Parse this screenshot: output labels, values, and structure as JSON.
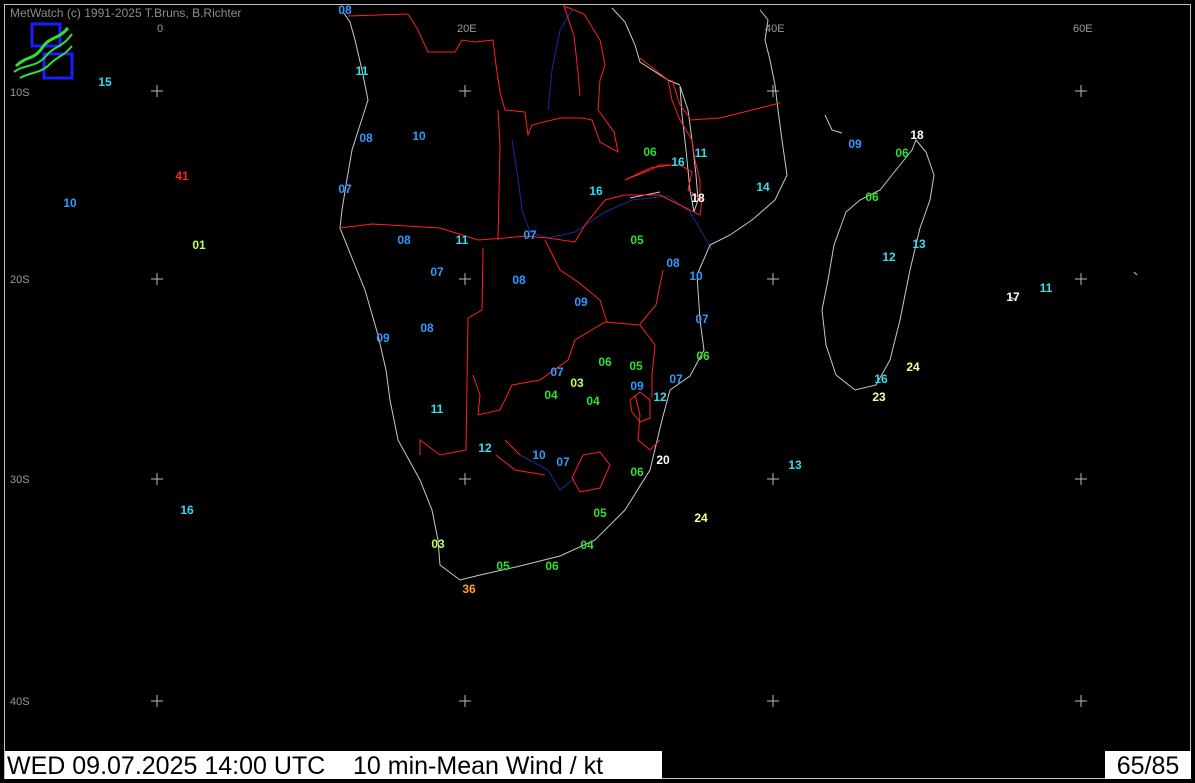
{
  "header": {
    "copyright": "MetWatch  (c) 1991-2025 T.Bruns, B.Richter"
  },
  "footer": {
    "datetime_product": "WED 09.07.2025 14:00 UTC    10 min-Mean Wind / kt",
    "station_count": "65/85"
  },
  "map": {
    "lon_labels": [
      "0",
      "20E",
      "40E",
      "60E"
    ],
    "lat_labels": [
      "10S",
      "20S",
      "30S",
      "40S"
    ],
    "colors": {
      "coast": "#c8c8c8",
      "border": "#ff2020",
      "river": "#1a2aa0",
      "grid": "#bbbbbb"
    },
    "legend_colors": {
      "blue": "#3399ff",
      "cyan": "#33ddee",
      "green": "#33dd33",
      "lime": "#bbff66",
      "white": "#ffffff",
      "yellow": "#ffff99",
      "orange": "#ffa030",
      "red": "#ff2020"
    },
    "wind_values": [
      "08",
      "11",
      "15",
      "08",
      "10",
      "07",
      "41",
      "10",
      "01",
      "06",
      "16",
      "11",
      "09",
      "18",
      "06",
      "16",
      "18",
      "14",
      "06",
      "05",
      "08",
      "11",
      "07",
      "10",
      "13",
      "12",
      "07",
      "08",
      "17",
      "11",
      "08",
      "09",
      "07",
      "08",
      "09",
      "06",
      "06",
      "05",
      "07",
      "03",
      "09",
      "07",
      "16",
      "24",
      "04",
      "04",
      "12",
      "23",
      "11",
      "12",
      "10",
      "07",
      "20",
      "06",
      "13",
      "16",
      "24",
      "05",
      "03",
      "04",
      "05",
      "06",
      "36"
    ]
  }
}
